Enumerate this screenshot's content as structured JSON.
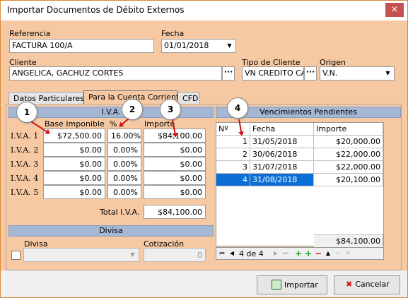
{
  "window": {
    "title": "Importar Documentos de Débito Externos",
    "close_glyph": "×"
  },
  "form": {
    "referencia_label": "Referencia",
    "referencia_value": "FACTURA 100/A",
    "fecha_label": "Fecha",
    "fecha_value": "01/01/2018",
    "cliente_label": "Cliente",
    "cliente_value": "ANGELICA, GACHUZ CORTES",
    "tipo_cliente_label": "Tipo de Cliente",
    "tipo_cliente_value": "VN CREDITO CAS.",
    "origen_label": "Origen",
    "origen_value": "V.N.",
    "dots": "···"
  },
  "tabs": [
    {
      "label": "Datos Particulares"
    },
    {
      "label": "Para la Cuenta Corriente"
    },
    {
      "label": "CFD"
    }
  ],
  "iva": {
    "band": "I.V.A.",
    "col_base": "Base Imponible",
    "col_pct": "%",
    "col_importe": "Importe",
    "rows": [
      {
        "label": "I.V.A. 1",
        "base": "$72,500.00",
        "pct": "16.00%",
        "importe": "$84,100.00"
      },
      {
        "label": "I.V.A. 2",
        "base": "$0.00",
        "pct": "0.00%",
        "importe": "$0.00"
      },
      {
        "label": "I.V.A. 3",
        "base": "$0.00",
        "pct": "0.00%",
        "importe": "$0.00"
      },
      {
        "label": "I.V.A. 4",
        "base": "$0.00",
        "pct": "0.00%",
        "importe": "$0.00"
      },
      {
        "label": "I.V.A. 5",
        "base": "$0.00",
        "pct": "0.00%",
        "importe": "$0.00"
      }
    ],
    "total_label": "Total I.V.A.",
    "total_value": "$84,100.00"
  },
  "divisa": {
    "band": "Divisa",
    "divisa_label": "Divisa",
    "cotizacion_label": "Cotización",
    "cotizacion_value": "0"
  },
  "vencimientos": {
    "band": "Vencimientos Pendientes",
    "headers": [
      "Nº",
      "Fecha",
      "Importe"
    ],
    "rows": [
      {
        "n": "1",
        "fecha": "31/05/2018",
        "importe": "$20,000.00"
      },
      {
        "n": "2",
        "fecha": "30/06/2018",
        "importe": "$22,000.00"
      },
      {
        "n": "3",
        "fecha": "31/07/2018",
        "importe": "$22,000.00"
      },
      {
        "n": "4",
        "fecha": "31/08/2018",
        "importe": "$20,100.00"
      }
    ],
    "total": "$84,100.00",
    "nav_record": "4 de 4"
  },
  "buttons": {
    "importar": "Importar",
    "cancelar": "Cancelar"
  },
  "callouts": [
    "1",
    "2",
    "3",
    "4"
  ],
  "colors": {
    "panel": "#f6c9a3",
    "band": "#a4b8d6",
    "selection": "#0b6fd6",
    "close": "#c75050",
    "arrow": "#d01010"
  }
}
